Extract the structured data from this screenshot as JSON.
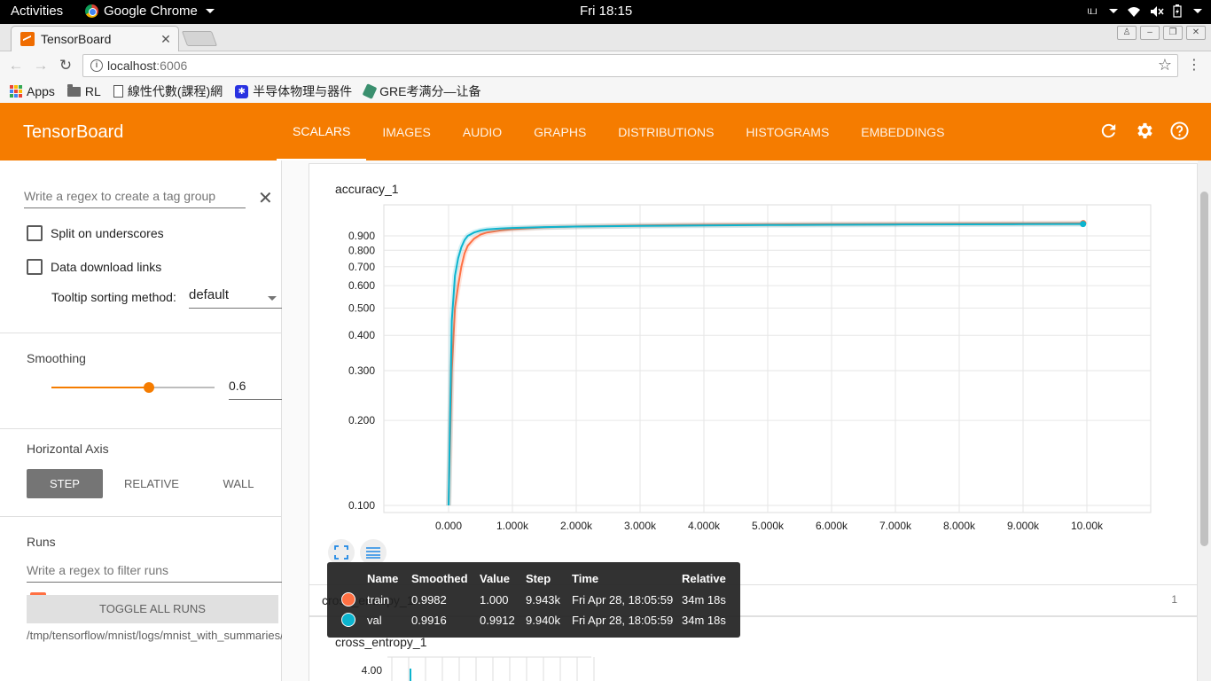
{
  "system": {
    "activities": "Activities",
    "app_name": "Google Chrome",
    "clock": "Fri 18:15",
    "input_method": "ய"
  },
  "browser": {
    "tab_title": "TensorBoard",
    "url_host": "localhost",
    "url_port": ":6006",
    "bookmarks": [
      {
        "label": "Apps",
        "icon": "apps-grid-icon"
      },
      {
        "label": "RL",
        "icon": "folder-icon"
      },
      {
        "label": "線性代數(課程)網",
        "icon": "page-icon"
      },
      {
        "label": "半导体物理与器件",
        "icon": "baidu-paw-icon"
      },
      {
        "label": "GRE考满分—让备",
        "icon": "gre-icon"
      }
    ]
  },
  "tensorboard": {
    "title": "TensorBoard",
    "tabs": [
      "SCALARS",
      "IMAGES",
      "AUDIO",
      "GRAPHS",
      "DISTRIBUTIONS",
      "HISTOGRAMS",
      "EMBEDDINGS"
    ],
    "active_tab": "SCALARS"
  },
  "sidebar": {
    "tag_regex_placeholder": "Write a regex to create a tag group",
    "split_underscores": "Split on underscores",
    "data_download": "Data download links",
    "tooltip_sort_label": "Tooltip sorting method:",
    "tooltip_sort_value": "default",
    "smoothing_label": "Smoothing",
    "smoothing_value": "0.6",
    "smoothing_fraction": 0.6,
    "horizontal_axis_label": "Horizontal Axis",
    "axis_options": [
      "STEP",
      "RELATIVE",
      "WALL"
    ],
    "axis_selected": "STEP",
    "runs_label": "Runs",
    "runs_regex_placeholder": "Write a regex to filter runs",
    "toggle_all_runs": "TOGGLE ALL RUNS",
    "log_path": "/tmp/tensorflow/mnist/logs/mnist_with_summaries/"
  },
  "main": {
    "accuracy_title": "accuracy_1",
    "group_name": "cross_entropy_1",
    "group_count": "1",
    "cross_entropy_title": "cross_entropy_1",
    "cross_entropy_tick": "4.00"
  },
  "tooltip": {
    "headers": [
      "Name",
      "Smoothed",
      "Value",
      "Step",
      "Time",
      "Relative"
    ],
    "rows": [
      {
        "name": "train",
        "smoothed": "0.9982",
        "value": "1.000",
        "step": "9.943k",
        "time": "Fri Apr 28, 18:05:59",
        "relative": "34m 18s",
        "color": "#ff7043"
      },
      {
        "name": "val",
        "smoothed": "0.9916",
        "value": "0.9912",
        "step": "9.940k",
        "time": "Fri Apr 28, 18:05:59",
        "relative": "34m 18s",
        "color": "#0cb4ce"
      }
    ]
  },
  "chart_data": {
    "type": "line",
    "title": "accuracy_1",
    "xlabel": "",
    "ylabel": "",
    "x_ticks": [
      "0.000",
      "1.000k",
      "2.000k",
      "3.000k",
      "4.000k",
      "5.000k",
      "6.000k",
      "7.000k",
      "8.000k",
      "9.000k",
      "10.00k"
    ],
    "y_ticks": [
      "0.900",
      "0.800",
      "0.700",
      "0.600",
      "0.500",
      "0.400",
      "0.300",
      "0.200",
      "0.100"
    ],
    "y_scale": "log",
    "xlim": [
      -1000,
      10000
    ],
    "ylim": [
      0.095,
      1.0
    ],
    "grid": true,
    "series": [
      {
        "name": "train",
        "color": "#ff7043",
        "x": [
          0,
          50,
          100,
          150,
          200,
          250,
          300,
          400,
          500,
          600,
          800,
          1000,
          1500,
          2000,
          3000,
          4000,
          5000,
          6000,
          7000,
          8000,
          9000,
          9943
        ],
        "y": [
          0.1,
          0.3,
          0.5,
          0.6,
          0.7,
          0.78,
          0.83,
          0.88,
          0.91,
          0.925,
          0.94,
          0.95,
          0.965,
          0.972,
          0.98,
          0.985,
          0.988,
          0.99,
          0.992,
          0.994,
          0.996,
          0.9982
        ]
      },
      {
        "name": "val",
        "color": "#0cb4ce",
        "x": [
          0,
          50,
          100,
          150,
          200,
          250,
          300,
          400,
          500,
          600,
          800,
          1000,
          1500,
          2000,
          3000,
          4000,
          5000,
          6000,
          7000,
          8000,
          9000,
          9940
        ],
        "y": [
          0.1,
          0.45,
          0.65,
          0.75,
          0.82,
          0.87,
          0.9,
          0.925,
          0.94,
          0.948,
          0.955,
          0.96,
          0.967,
          0.971,
          0.976,
          0.98,
          0.983,
          0.985,
          0.987,
          0.989,
          0.99,
          0.9916
        ]
      }
    ]
  }
}
